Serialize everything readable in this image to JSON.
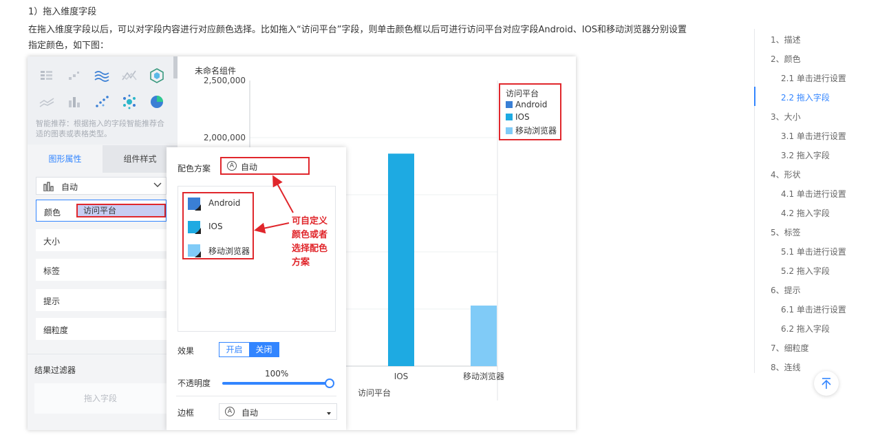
{
  "doc": {
    "heading": "1）拖入维度字段",
    "paragraph": "在拖入维度字段以后，可以对字段内容进行对应颜色选择。比如拖入“访问平台”字段，则单击颜色框以后可进行访问平台对应字段Android、IOS和移动浏览器分别设置指定颜色，如下图："
  },
  "editor": {
    "recommend_text": "智能推荐：根据拖入的字段智能推荐合适的图表或表格类型。",
    "tabs": {
      "shape": "图形属性",
      "style": "组件样式"
    },
    "chart_type_select": "自动",
    "props": {
      "color_label": "颜色",
      "color_field": "访问平台",
      "size": "大小",
      "label": "标签",
      "tip": "提示",
      "granularity": "细粒度"
    },
    "filter": {
      "title": "结果过滤器",
      "drop": "拖入字段"
    }
  },
  "chart_data": {
    "type": "bar",
    "title": "未命名组件",
    "xlabel": "访问平台",
    "ylabel": "",
    "categories": [
      "Android",
      "IOS",
      "移动浏览器"
    ],
    "values": [
      null,
      1860000,
      530000
    ],
    "colors": [
      "#3a7fd5",
      "#1eaae2",
      "#80cbf7"
    ],
    "y_ticks": [
      "2,500,000",
      "2,000,000"
    ],
    "ylim": [
      0,
      2500000
    ],
    "visible_x_labels": [
      "IOS",
      "移动浏览器"
    ],
    "legend": {
      "title": "访问平台",
      "placement": "top-right",
      "items": [
        {
          "name": "Android",
          "color": "#3a7fd5"
        },
        {
          "name": "IOS",
          "color": "#1eaae2"
        },
        {
          "name": "移动浏览器",
          "color": "#80cbf7"
        }
      ]
    }
  },
  "popup": {
    "scheme_label": "配色方案",
    "scheme_value": "自动",
    "scheme_badge": "A",
    "swatches": [
      {
        "name": "Android",
        "color": "#3a7fd5"
      },
      {
        "name": "IOS",
        "color": "#1eaae2"
      },
      {
        "name": "移动浏览器",
        "color": "#80cbf7"
      }
    ],
    "effect_label": "效果",
    "effect_on": "开启",
    "effect_off": "关闭",
    "opacity_label": "不透明度",
    "opacity_value": "100%",
    "opacity_level": 1.0,
    "border_label": "边框",
    "border_value": "自动",
    "border_badge": "A"
  },
  "annotation": {
    "text": "可自定义颜色或者选择配色方案"
  },
  "toc": {
    "active": "2.2 拖入字段",
    "items": [
      {
        "text": "1、描述",
        "level": 1
      },
      {
        "text": "2、颜色",
        "level": 1
      },
      {
        "text": "2.1 单击进行设置",
        "level": 2
      },
      {
        "text": "2.2 拖入字段",
        "level": 2
      },
      {
        "text": "3、大小",
        "level": 1
      },
      {
        "text": "3.1 单击进行设置",
        "level": 2
      },
      {
        "text": "3.2 拖入字段",
        "level": 2
      },
      {
        "text": "4、形状",
        "level": 1
      },
      {
        "text": "4.1 单击进行设置",
        "level": 2
      },
      {
        "text": "4.2 拖入字段",
        "level": 2
      },
      {
        "text": "5、标签",
        "level": 1
      },
      {
        "text": "5.1 单击进行设置",
        "level": 2
      },
      {
        "text": "5.2 拖入字段",
        "level": 2
      },
      {
        "text": "6、提示",
        "level": 1
      },
      {
        "text": "6.1 单击进行设置",
        "level": 2
      },
      {
        "text": "6.2 拖入字段",
        "level": 2
      },
      {
        "text": "7、细粒度",
        "level": 1
      },
      {
        "text": "8、连线",
        "level": 1
      }
    ]
  },
  "icons": {
    "chart_types": [
      "table-grid-icon",
      "scatter-small-icon",
      "multi-line-icon",
      "radar-line-icon",
      "hexagon-icon",
      "area-line-icon",
      "bar-small-icon",
      "dot-scatter-icon",
      "bubble-cluster-icon",
      "pie-icon"
    ],
    "back_to_top": "arrow-up-to-top-icon"
  }
}
